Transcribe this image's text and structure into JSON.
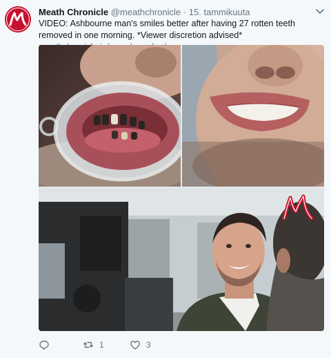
{
  "tweet": {
    "author_name": "Meath Chronicle",
    "author_handle": "@meathchronicle",
    "separator": "·",
    "timestamp": "15. tammikuuta",
    "text": "VIDEO: Ashbourne man's smiles better after having 27 rotten teeth removed in one morning. *Viewer discretion advised* ",
    "link_text": "meathchronicle.ie/news/roundup/a...",
    "avatar_logo_letters": "M",
    "watermark_letters": "M",
    "retweet_count": "1",
    "like_count": "3"
  },
  "icons": {
    "caret": "chevron-down-icon",
    "reply": "reply-icon",
    "retweet": "retweet-icon",
    "like": "heart-icon"
  },
  "colors": {
    "brand_red": "#c8102e",
    "link_blue": "#1b95e0",
    "muted": "#657786",
    "background": "#f5f8fa"
  }
}
